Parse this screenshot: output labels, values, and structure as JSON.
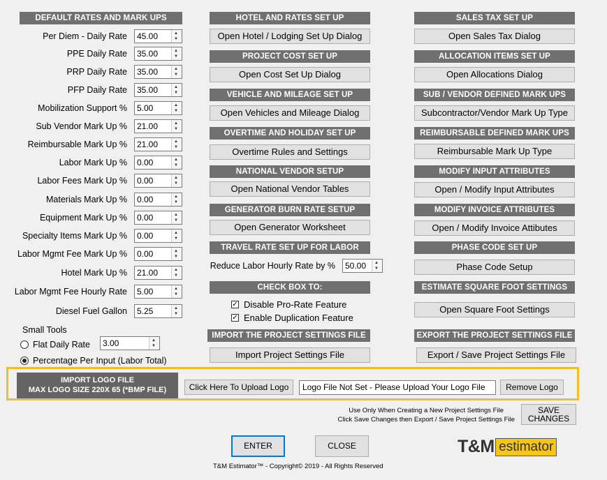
{
  "defaults": {
    "header": "DEFAULT RATES AND MARK UPS",
    "rows": [
      {
        "label": "Per Diem - Daily Rate",
        "value": "45.00"
      },
      {
        "label": "PPE Daily Rate",
        "value": "35.00"
      },
      {
        "label": "PRP Daily Rate",
        "value": "35.00"
      },
      {
        "label": "PFP Daily Rate",
        "value": "35.00"
      },
      {
        "label": "Mobilization Support %",
        "value": "5.00"
      },
      {
        "label": "Sub Vendor Mark Up %",
        "value": "21.00"
      },
      {
        "label": "Reimbursable Mark Up %",
        "value": "21.00"
      },
      {
        "label": "Labor Mark Up  %",
        "value": "0.00"
      },
      {
        "label": "Labor Fees Mark Up  %",
        "value": "0.00"
      },
      {
        "label": "Materials Mark Up  %",
        "value": "0.00"
      },
      {
        "label": "Equipment Mark Up  %",
        "value": "0.00"
      },
      {
        "label": "Specialty Items Mark Up  %",
        "value": "0.00"
      },
      {
        "label": "Labor Mgmt Fee Mark Up  %",
        "value": "0.00"
      },
      {
        "label": "Hotel Mark Up  %",
        "value": "21.00"
      },
      {
        "label": "Labor Mgmt Fee Hourly Rate",
        "value": "5.00"
      },
      {
        "label": "Diesel Fuel Gallon",
        "value": "5.25"
      }
    ],
    "small_tools": {
      "label": "Small Tools",
      "flat_label": "Flat Daily Rate",
      "flat_value": "3.00",
      "pct_label": "Percentage Per Input (Labor Total)"
    }
  },
  "middle": {
    "hotel_header": "HOTEL AND RATES SET UP",
    "hotel_button": "Open Hotel / Lodging Set Up Dialog",
    "project_cost_header": "PROJECT COST SET UP",
    "project_cost_button": "Open Cost Set Up Dialog",
    "vehicle_header": "VEHICLE AND MILEAGE SET UP",
    "vehicle_button": "Open Vehicles and Mileage Dialog",
    "overtime_header": "OVERTIME AND HOLIDAY SET UP",
    "overtime_button": "Overtime Rules and Settings",
    "vendor_header": "NATIONAL VENDOR SETUP",
    "vendor_button": "Open National Vendor Tables",
    "generator_header": "GENERATOR BURN RATE SETUP",
    "generator_button": "Open Generator Worksheet",
    "travel_header": "TRAVEL RATE SET UP FOR LABOR",
    "travel_label": "Reduce Labor Hourly Rate by %",
    "travel_value": "50.00",
    "checkbox_header": "CHECK BOX TO:",
    "check1": "Disable Pro-Rate Feature",
    "check2": "Enable Duplication Feature",
    "import_header": "IMPORT THE PROJECT SETTINGS FILE",
    "import_button": "Import Project Settings File"
  },
  "right": {
    "tax_header": "SALES TAX SET UP",
    "tax_button": "Open Sales Tax Dialog",
    "alloc_header": "ALLOCATION ITEMS SET UP",
    "alloc_button": "Open Allocations Dialog",
    "sub_header": "SUB / VENDOR DEFINED MARK UPS",
    "sub_button": "Subcontractor/Vendor Mark Up Type",
    "reimb_header": "REIMBURSABLE DEFINED MARK UPS",
    "reimb_button": "Reimbursable Mark Up Type",
    "input_header": "MODIFY INPUT ATTRIBUTES",
    "input_button": "Open / Modify Input Attributes",
    "invoice_header": "MODIFY INVOICE ATTRIBUTES",
    "invoice_button": "Open / Modify  Invoice Attibutes",
    "phase_header": "PHASE CODE SET UP",
    "phase_button": "Phase Code Setup",
    "sqft_header": "ESTIMATE SQUARE FOOT SETTINGS",
    "sqft_button": "Open Square Foot Settings",
    "export_header": "EXPORT THE PROJECT SETTINGS FILE",
    "export_button": "Export / Save Project  Settings File"
  },
  "logo": {
    "label_line1": "IMPORT LOGO FILE",
    "label_line2": "MAX LOGO SIZE 220X 65 (*BMP FILE)",
    "upload_button": "Click Here To Upload Logo",
    "file_value": "Logo File Not Set - Please Upload Your Logo File",
    "remove_button": "Remove Logo"
  },
  "save": {
    "note1": "Use Only When Creating a New Project Settings File",
    "note2": "Click Save Changes then Export / Save Project Settings File",
    "button_line1": "SAVE",
    "button_line2": "CHANGES"
  },
  "footer": {
    "enter": "ENTER",
    "close": "CLOSE",
    "copyright": "T&M Estimator™ - Copyright© 2019 - All Rights Reserved",
    "brand_tm": "T&M",
    "brand_estimator": "estimator"
  },
  "colors": {
    "header_bg": "#707070",
    "highlight_border": "#f0c020",
    "logo_label_bg": "#646464",
    "enter_border": "#0078d7",
    "brand_yellow": "#f5c518"
  }
}
